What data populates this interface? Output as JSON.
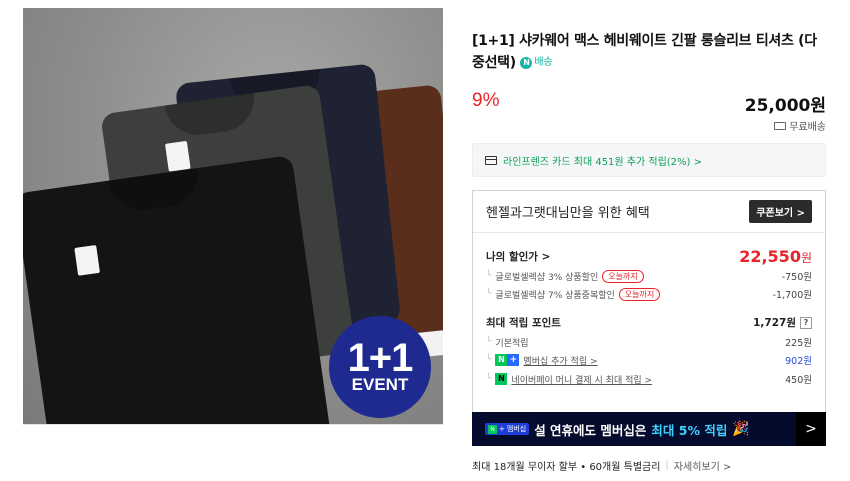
{
  "product": {
    "event_badge": {
      "big": "1+1",
      "small": "EVENT"
    },
    "title": "[1+1] 샤카웨어 맥스 헤비웨이트 긴팔 롱슬리브 티셔츠 (다중선택)",
    "delivery_badge": "배송",
    "discount": "9%",
    "price": "25,000원",
    "shipping": "무료배송",
    "card_promo": "라인프렌즈 카드 최대 451원 추가 적립(2%) >"
  },
  "benefit": {
    "title": "헨젤과그랫대님만을 위한 혜택",
    "coupon_button": "쿠폰보기 >",
    "my_price_label": "나의 할인가 >",
    "my_price_value": "22,550",
    "my_price_unit": "원",
    "discounts": [
      {
        "label": "글로벌셀렉샵 3% 상품할인",
        "pill": "오늘까지",
        "amount": "-750원"
      },
      {
        "label": "글로벌셀렉샵 7% 상품중복할인",
        "pill": "오늘까지",
        "amount": "-1,700원"
      }
    ],
    "points_label": "최대 적립 포인트",
    "points_total": "1,727원",
    "points_help": "?",
    "points": [
      {
        "label": "기본적립",
        "amount": "225원"
      },
      {
        "label": "멤버십 추가 적립 >",
        "amount": "902원"
      },
      {
        "label": "네이버페이 머니 결제 시 최대 적립 >",
        "amount": "450원"
      }
    ]
  },
  "banner": {
    "tag": "멤버십",
    "text_prefix": "설 연휴에도 멤버십은",
    "text_highlight": "최대 5% 적립",
    "arrow": ">"
  },
  "installment": {
    "text": "최대 18개월 무이자 할부 • 60개월 특별금리",
    "more": "자세히보기 >"
  }
}
